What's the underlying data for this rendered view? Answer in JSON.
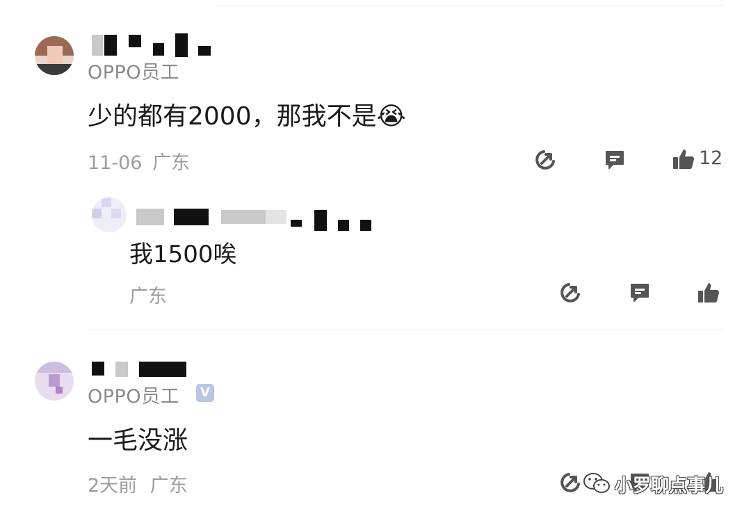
{
  "comments": [
    {
      "user_tag": "OPPO员工",
      "text": "少的都有2000，那我不是😭",
      "date": "11-06",
      "location": "广东",
      "likes": "12",
      "replies": [
        {
          "text": "我1500唉",
          "location": "广东"
        }
      ]
    },
    {
      "user_tag": "OPPO员工",
      "verified_badge": "V",
      "text": "一毛没涨",
      "date": "2天前",
      "location": "广东"
    }
  ],
  "watermark": "小罗聊点事儿",
  "icons": [
    "share-icon",
    "reply-icon",
    "thumbs-up-icon",
    "wechat-logo-icon"
  ]
}
